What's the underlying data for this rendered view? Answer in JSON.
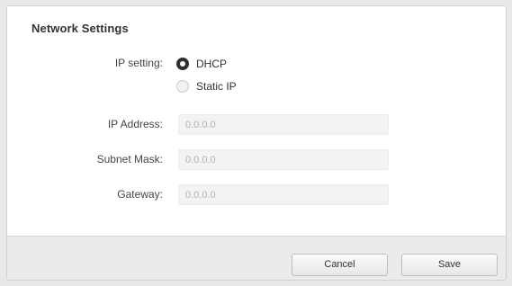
{
  "dialog": {
    "title": "Network Settings"
  },
  "ip_setting": {
    "label": "IP setting:",
    "options": [
      {
        "label": "DHCP",
        "selected": true
      },
      {
        "label": "Static IP",
        "selected": false
      }
    ]
  },
  "fields": {
    "ip_address": {
      "label": "IP Address:",
      "placeholder": "0.0.0.0"
    },
    "subnet_mask": {
      "label": "Subnet Mask:",
      "placeholder": "0.0.0.0"
    },
    "gateway": {
      "label": "Gateway:",
      "placeholder": "0.0.0.0"
    }
  },
  "footer": {
    "cancel_label": "Cancel",
    "save_label": "Save"
  },
  "colors": {
    "background": "#e9e9e9",
    "panel": "#ffffff",
    "footer": "#ebebeb",
    "field": "#f3f3f3"
  }
}
